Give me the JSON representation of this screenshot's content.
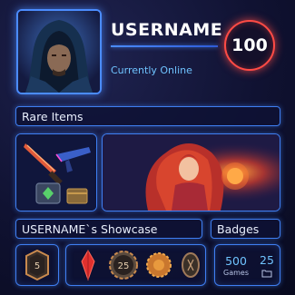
{
  "profile": {
    "username": "USERNAME",
    "status": "Currently Online",
    "level": "100"
  },
  "sections": {
    "rare_items": "Rare Items",
    "showcase": "USERNAME`s Showcase",
    "badges": "Badges"
  },
  "badges": {
    "small_badge_value": "5",
    "row_badge_value": "25"
  },
  "stats": {
    "games_count": "500",
    "games_label": "Games",
    "folders_count": "25",
    "folder_icon": "folder-icon"
  },
  "colors": {
    "accent": "#3f7ff2",
    "status": "#6fc3ff",
    "level_ring": "#ff4b45"
  }
}
